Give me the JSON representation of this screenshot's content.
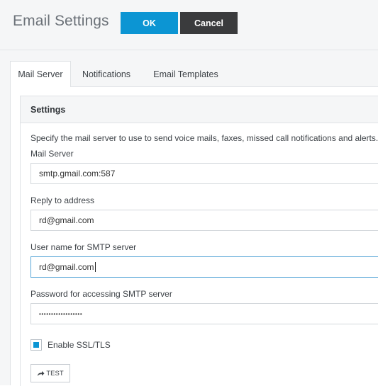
{
  "header": {
    "title": "Email Settings",
    "ok_label": "OK",
    "cancel_label": "Cancel"
  },
  "tabs": [
    {
      "label": "Mail Server",
      "active": true
    },
    {
      "label": "Notifications",
      "active": false
    },
    {
      "label": "Email Templates",
      "active": false
    }
  ],
  "settings": {
    "heading": "Settings",
    "description": "Specify the mail server to use to send voice mails, faxes, missed call notifications and alerts.",
    "fields": [
      {
        "label": "Mail Server",
        "value": "smtp.gmail.com:587"
      },
      {
        "label": "Reply to address",
        "value": "rd@gmail.com"
      },
      {
        "label": "User name for SMTP server",
        "value": "rd@gmail.com"
      },
      {
        "label": "Password for accessing SMTP server",
        "value": "••••••••••••••••••"
      }
    ],
    "ssl_label": "Enable SSL/TLS",
    "ssl_checked": true,
    "test_label": "TEST"
  },
  "colors": {
    "accent": "#0c95d3",
    "cancel": "#3a3b3d",
    "focus_border": "#59a7d8"
  },
  "icons": {
    "test": "share-arrow-icon"
  }
}
